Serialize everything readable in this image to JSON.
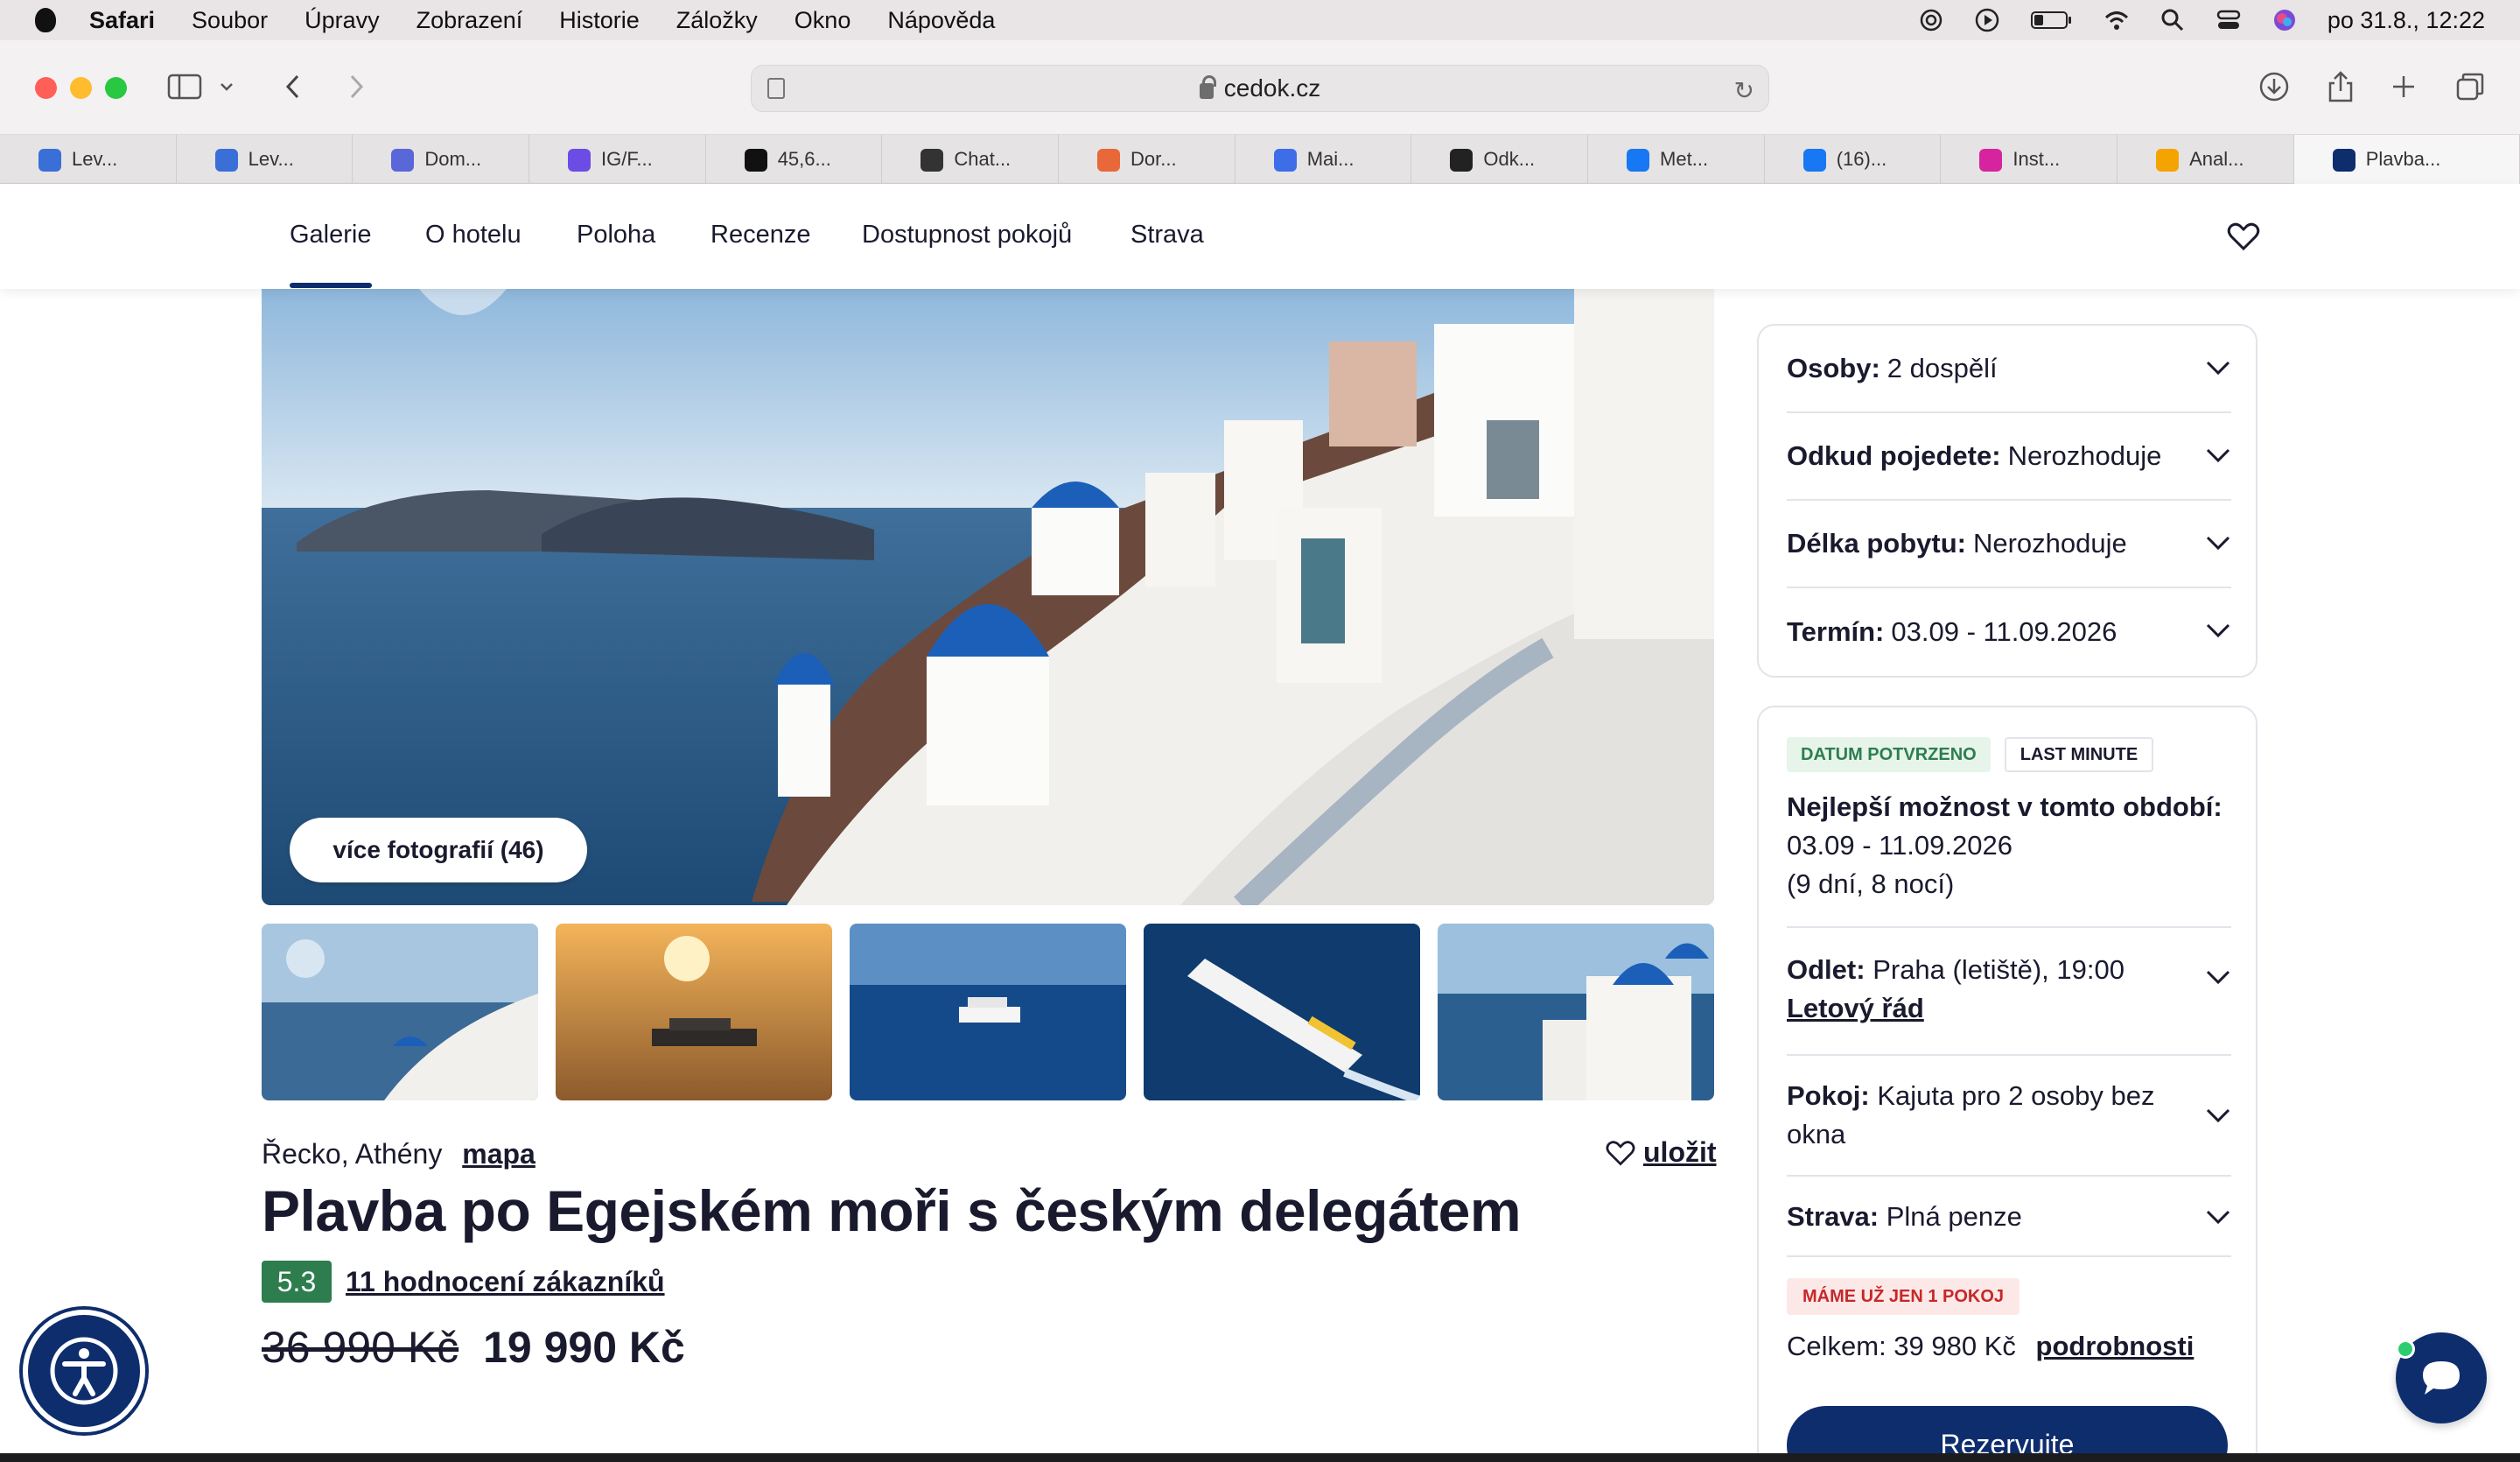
{
  "menubar": {
    "app": "Safari",
    "items": [
      "Soubor",
      "Úpravy",
      "Zobrazení",
      "Historie",
      "Záložky",
      "Okno",
      "Nápověda"
    ],
    "clock": "po 31.8., 12:22"
  },
  "browser": {
    "url": "cedok.cz"
  },
  "tabs": [
    {
      "title": "Lev...",
      "color": "#3b6fd8"
    },
    {
      "title": "Lev...",
      "color": "#3b6fd8"
    },
    {
      "title": "Dom...",
      "color": "#5a67d8"
    },
    {
      "title": "IG/F...",
      "color": "#6b4de6"
    },
    {
      "title": "45,6...",
      "color": "#111111"
    },
    {
      "title": "Chat...",
      "color": "#333333"
    },
    {
      "title": "Dor...",
      "color": "#e8683a"
    },
    {
      "title": "Mai...",
      "color": "#3d6ee8"
    },
    {
      "title": "Odk...",
      "color": "#222222"
    },
    {
      "title": "Met...",
      "color": "#1877f2"
    },
    {
      "title": "(16)...",
      "color": "#1877f2"
    },
    {
      "title": "Inst...",
      "color": "#d6249f"
    },
    {
      "title": "Anal...",
      "color": "#f4a300"
    },
    {
      "title": "Plavba...",
      "color": "#0e2d6d"
    }
  ],
  "nav": {
    "items": [
      "Galerie",
      "O hotelu",
      "Poloha",
      "Recenze",
      "Dostupnost pokojů",
      "Strava"
    ]
  },
  "gallery": {
    "more_photos": "více fotografií (46)",
    "thumbnails": [
      "santorini-village",
      "ship-sunset",
      "ship-sea",
      "ship-aerial",
      "santorini-domes"
    ]
  },
  "hotel": {
    "location": "Řecko, Athény",
    "map_link": "mapa",
    "save_label": "uložit",
    "title": "Plavba po Egejském moři s českým delegátem",
    "rating": "5.3",
    "reviews": "11 hodnocení zákazníků",
    "old_price": "36 990 Kč",
    "new_price": "19 990 Kč"
  },
  "filters": {
    "persons_label": "Osoby:",
    "persons_value": "2 dospělí",
    "from_label": "Odkud pojedete:",
    "from_value": "Nerozhoduje",
    "length_label": "Délka pobytu:",
    "length_value": "Nerozhoduje",
    "date_label": "Termín:",
    "date_value": "03.09 - 11.09.2026"
  },
  "offer": {
    "badge_confirmed": "DATUM POTVRZENO",
    "badge_last_minute": "LAST MINUTE",
    "best_label": "Nejlepší možnost v tomto období:",
    "best_dates": "03.09 - 11.09.2026",
    "best_duration": "(9 dní, 8 nocí)",
    "departure_label": "Odlet:",
    "departure_value": "Praha (letiště), 19:00",
    "schedule_link": "Letový řád",
    "room_label": "Pokoj:",
    "room_value": "Kajuta pro 2 osoby bez okna",
    "board_label": "Strava:",
    "board_value": "Plná penze",
    "warning": "MÁME UŽ JEN 1 POKOJ",
    "total_label": "Celkem: 39 980 Kč",
    "details_link": "podrobnosti",
    "reserve": "Rezervujte"
  },
  "colors": {
    "brand_navy": "#0e2d6d",
    "rating_green": "#2e7d4f",
    "warning_red": "#c62828"
  }
}
